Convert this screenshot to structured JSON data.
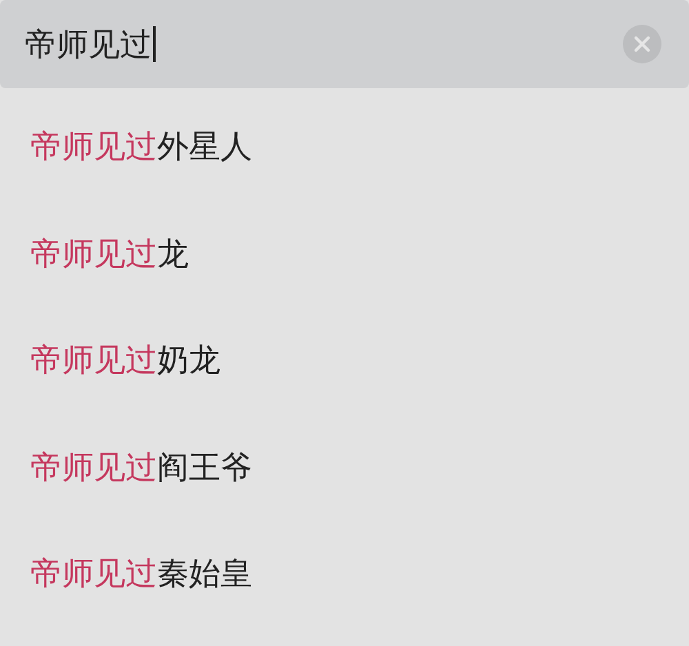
{
  "search": {
    "value": "帝师见过",
    "focused": true
  },
  "suggestions": [
    {
      "match": "帝师见过",
      "rest": "外星人"
    },
    {
      "match": "帝师见过",
      "rest": "龙"
    },
    {
      "match": "帝师见过",
      "rest": "奶龙"
    },
    {
      "match": "帝师见过",
      "rest": "阎王爷"
    },
    {
      "match": "帝师见过",
      "rest": "秦始皇"
    }
  ]
}
